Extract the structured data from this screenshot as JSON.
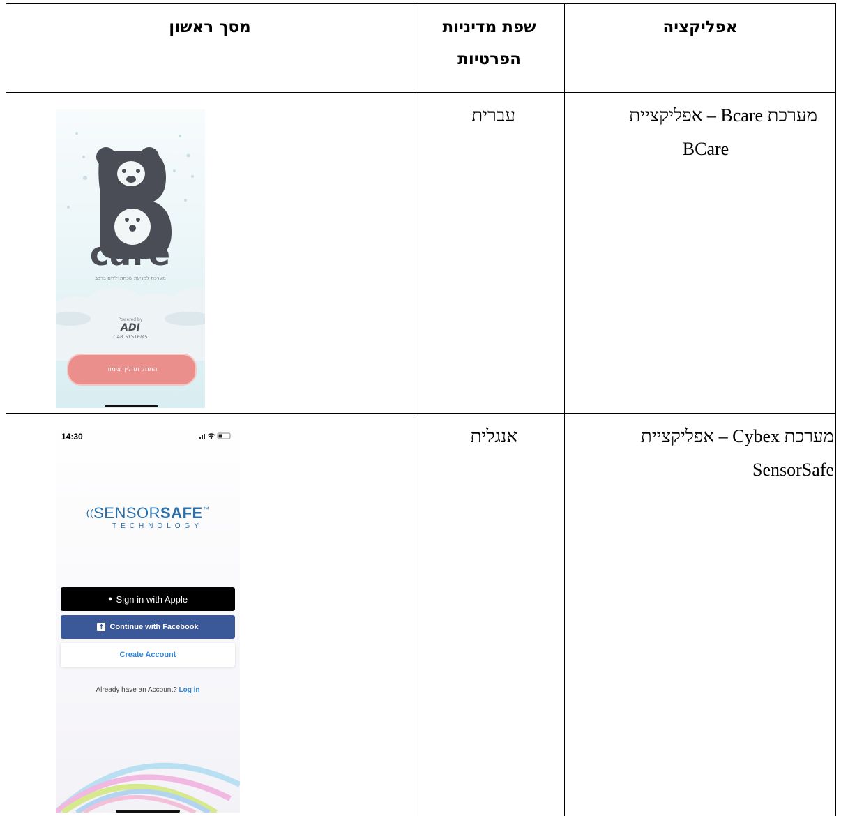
{
  "table": {
    "headers": {
      "app": "אפליקציה",
      "language_line1": "שפת מדיניות",
      "language_line2": "הפרטיות",
      "screen": "מסך ראשון"
    },
    "rows": [
      {
        "app_line1": "מערכת Bcare – אפליקציית",
        "app_line2": "BCare",
        "language": "עברית"
      },
      {
        "app_line1": "מערכת Cybex – אפליקציית",
        "app_line2": "SensorSafe",
        "language": "אנגלית"
      }
    ]
  },
  "bcare_screen": {
    "logo_text": "care",
    "tagline": "מערכת למניעת שכחת ילדים ברכב",
    "powered_by": "Powered by",
    "brand": "ADI",
    "brand_sub": "CAR SYSTEMS",
    "cta_label": "התחל תהליך צימוד"
  },
  "sensorsafe_screen": {
    "time": "14:30",
    "logo_main_thin": "SENSOR",
    "logo_main_bold": "SAFE",
    "logo_tm": "™",
    "logo_sub": "TECHNOLOGY",
    "apple_button": "Sign in with Apple",
    "facebook_button": "Continue with Facebook",
    "create_account": "Create Account",
    "already_text": "Already have an Account?",
    "login_link": "Log in"
  },
  "colors": {
    "bcare_bear": "#4a4d55",
    "bcare_button": "#ea8f8c",
    "facebook_blue": "#3b5998",
    "link_blue": "#2f86d8"
  }
}
